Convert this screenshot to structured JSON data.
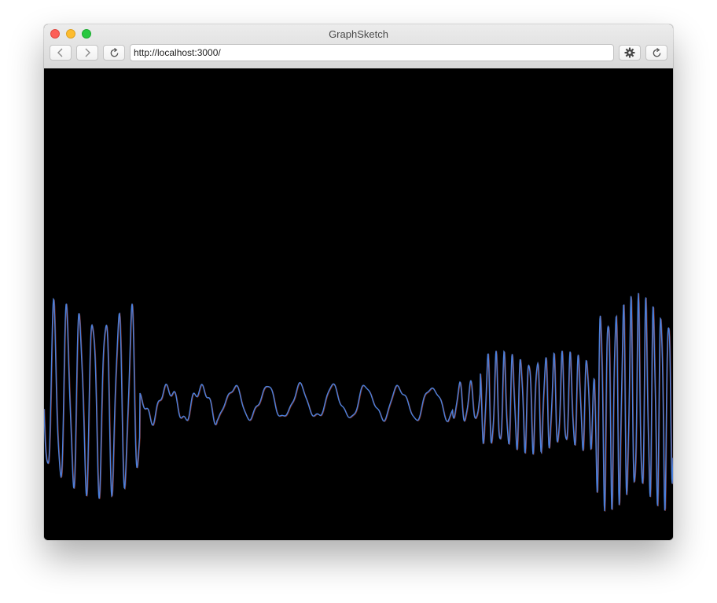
{
  "window": {
    "title": "GraphSketch"
  },
  "toolbar": {
    "url": "http://localhost:3000/"
  },
  "canvas": {
    "background": "#000000",
    "waveform_color": "#4a80dc",
    "highlight_color": "#e05a4a"
  }
}
